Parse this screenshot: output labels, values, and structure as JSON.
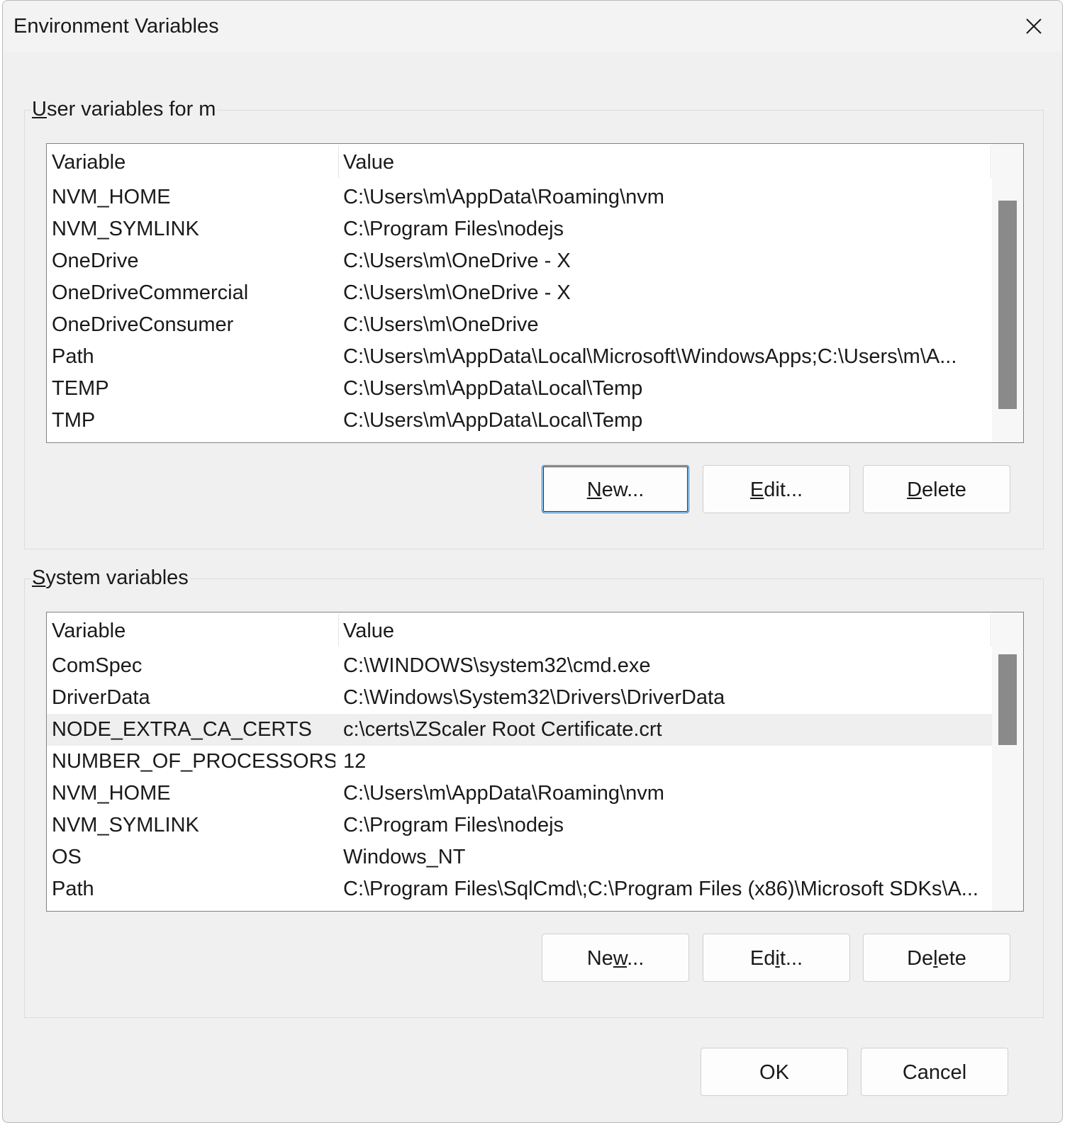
{
  "window": {
    "title": "Environment Variables"
  },
  "user_vars": {
    "label": "User variables for m",
    "label_mnemonic": "U",
    "label_rest": "ser variables for m",
    "columns": {
      "variable": "Variable",
      "value": "Value"
    },
    "rows": [
      {
        "variable": "NVM_HOME",
        "value": "C:\\Users\\m\\AppData\\Roaming\\nvm"
      },
      {
        "variable": "NVM_SYMLINK",
        "value": "C:\\Program Files\\nodejs"
      },
      {
        "variable": "OneDrive",
        "value": "C:\\Users\\m\\OneDrive - X"
      },
      {
        "variable": "OneDriveCommercial",
        "value": "C:\\Users\\m\\OneDrive - X"
      },
      {
        "variable": "OneDriveConsumer",
        "value": "C:\\Users\\m\\OneDrive"
      },
      {
        "variable": "Path",
        "value": "C:\\Users\\m\\AppData\\Local\\Microsoft\\WindowsApps;C:\\Users\\m\\A..."
      },
      {
        "variable": "TEMP",
        "value": "C:\\Users\\m\\AppData\\Local\\Temp"
      },
      {
        "variable": "TMP",
        "value": "C:\\Users\\m\\AppData\\Local\\Temp"
      }
    ],
    "buttons": {
      "new": {
        "pre": "",
        "mn": "N",
        "post": "ew..."
      },
      "edit": {
        "pre": "",
        "mn": "E",
        "post": "dit..."
      },
      "delete": {
        "pre": "",
        "mn": "D",
        "post": "elete"
      }
    }
  },
  "system_vars": {
    "label": "System variables",
    "label_mnemonic": "S",
    "label_rest": "ystem variables",
    "columns": {
      "variable": "Variable",
      "value": "Value"
    },
    "selected_row": "NODE_EXTRA_CA_CERTS",
    "rows": [
      {
        "variable": "ComSpec",
        "value": "C:\\WINDOWS\\system32\\cmd.exe"
      },
      {
        "variable": "DriverData",
        "value": "C:\\Windows\\System32\\Drivers\\DriverData"
      },
      {
        "variable": "NODE_EXTRA_CA_CERTS",
        "value": "c:\\certs\\ZScaler Root Certificate.crt"
      },
      {
        "variable": "NUMBER_OF_PROCESSORS",
        "value": "12"
      },
      {
        "variable": "NVM_HOME",
        "value": "C:\\Users\\m\\AppData\\Roaming\\nvm"
      },
      {
        "variable": "NVM_SYMLINK",
        "value": "C:\\Program Files\\nodejs"
      },
      {
        "variable": "OS",
        "value": "Windows_NT"
      },
      {
        "variable": "Path",
        "value": "C:\\Program Files\\SqlCmd\\;C:\\Program Files (x86)\\Microsoft SDKs\\A..."
      }
    ],
    "buttons": {
      "new": {
        "pre": "Ne",
        "mn": "w",
        "post": "..."
      },
      "edit": {
        "pre": "Ed",
        "mn": "i",
        "post": "t..."
      },
      "delete": {
        "pre": "De",
        "mn": "l",
        "post": "ete"
      }
    }
  },
  "footer": {
    "ok": "OK",
    "cancel": "Cancel"
  },
  "icons": {
    "close": "close-icon"
  }
}
